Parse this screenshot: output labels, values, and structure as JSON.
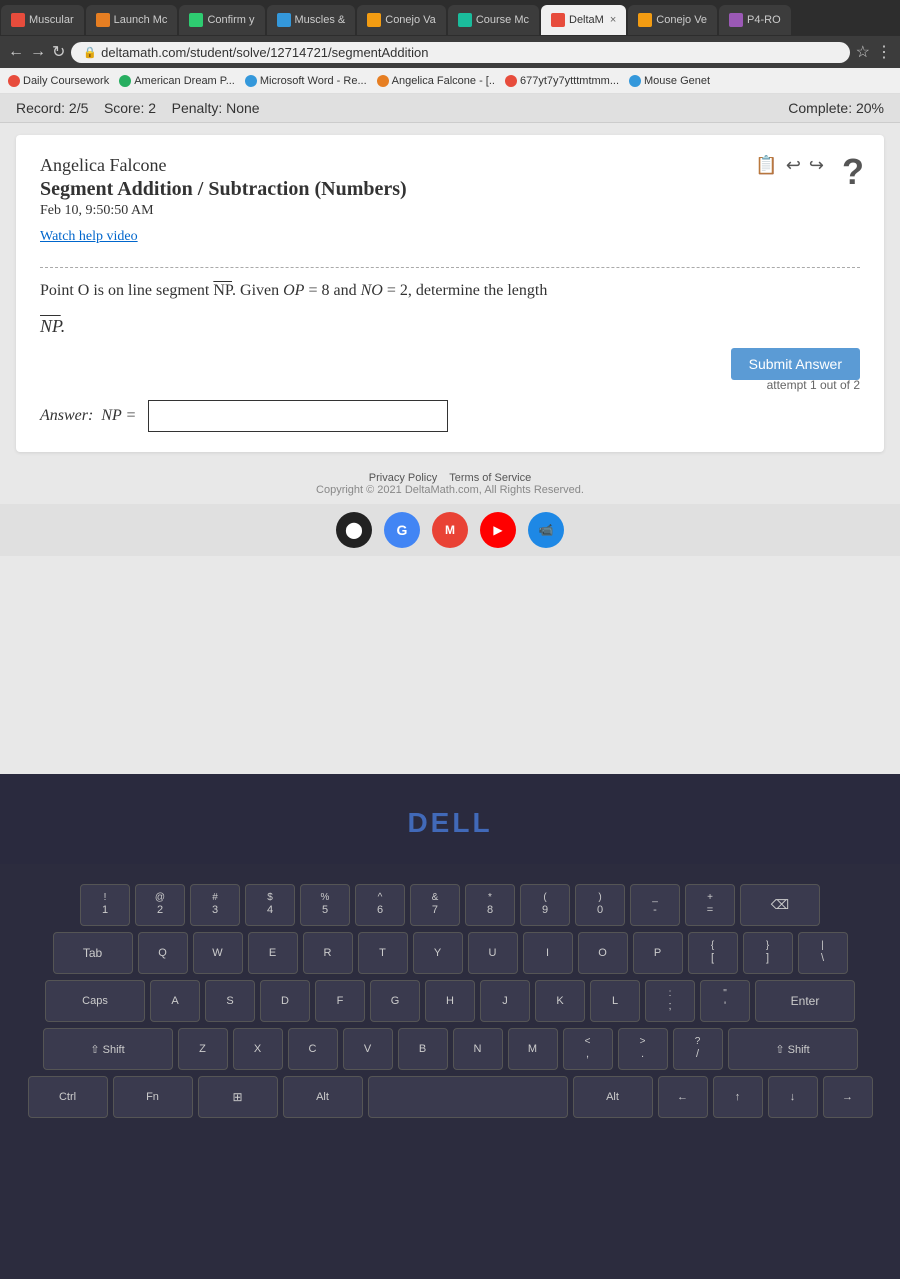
{
  "browser": {
    "tabs": [
      {
        "id": "muscular",
        "label": "Muscular",
        "active": false,
        "icon_color": "#e74c3c"
      },
      {
        "id": "launch-mc",
        "label": "Launch Mc",
        "active": false,
        "icon_color": "#e67e22"
      },
      {
        "id": "confirm",
        "label": "Confirm y",
        "active": false,
        "icon_color": "#2ecc71"
      },
      {
        "id": "muscles",
        "label": "Muscles &",
        "active": false,
        "icon_color": "#3498db"
      },
      {
        "id": "conejo-va",
        "label": "Conejo Va",
        "active": false,
        "icon_color": "#f39c12"
      },
      {
        "id": "course-mc",
        "label": "Course Mc",
        "active": false,
        "icon_color": "#1abc9c"
      },
      {
        "id": "deltam",
        "label": "DeltaM",
        "active": true,
        "icon_color": "#e74c3c"
      },
      {
        "id": "conejo-ve",
        "label": "Conejo Ve",
        "active": false,
        "icon_color": "#f39c12"
      },
      {
        "id": "p4-ro",
        "label": "P4-RO",
        "active": false,
        "icon_color": "#9b59b6"
      }
    ],
    "address": "deltamath.com/student/solve/12714721/segmentAddition"
  },
  "bookmarks": [
    {
      "label": "Daily Coursework",
      "color": "#e74c3c"
    },
    {
      "label": "American Dream P...",
      "color": "#27ae60"
    },
    {
      "label": "Microsoft Word - Re...",
      "color": "#3498db"
    },
    {
      "label": "Angelica Falcone - [..",
      "color": "#e67e22"
    },
    {
      "label": "677yt7y7ytttmtmm...",
      "color": "#e74c3c"
    },
    {
      "label": "Mouse Genet",
      "color": "#3498db"
    }
  ],
  "record_bar": {
    "record": "Record: 2/5",
    "score": "Score: 2",
    "penalty": "Penalty: None",
    "complete": "Complete: 20%"
  },
  "problem": {
    "student_name": "Angelica Falcone",
    "subject": "Segment Addition / Subtraction (Numbers)",
    "date": "Feb 10, 9:50:50 AM",
    "watch_video": "Watch help video",
    "problem_line1": "Point O is on line segment NP. Given OP = 8 and NO = 2, determine the length",
    "problem_line2": "NP.",
    "answer_label": "Answer:  NP =",
    "submit_button": "Submit Answer",
    "attempt_text": "attempt 1 out of 2"
  },
  "footer": {
    "privacy": "Privacy Policy",
    "terms": "Terms of Service",
    "copyright": "Copyright © 2021 DeltaMath.com, All Rights Reserved."
  },
  "dell": {
    "logo": "DELL"
  },
  "keyboard": {
    "rows": [
      [
        "!",
        "@",
        "#",
        "$",
        "%",
        "^",
        "&",
        "*",
        "(",
        ")",
        "_",
        "+"
      ],
      [
        "Q",
        "W",
        "E",
        "R",
        "T",
        "Y",
        "U",
        "I",
        "O",
        "P",
        "{",
        "}"
      ],
      [
        "A",
        "S",
        "D",
        "F",
        "G",
        "H",
        "J",
        "K",
        "L",
        ":",
        "\""
      ],
      [
        "Z",
        "X",
        "C",
        "V",
        "B",
        "N",
        "M",
        "<",
        ">",
        "?"
      ]
    ]
  }
}
